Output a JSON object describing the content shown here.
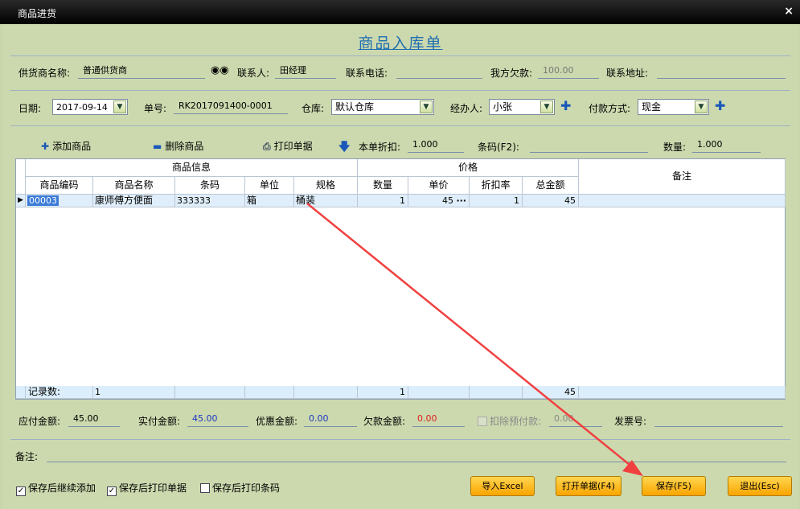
{
  "window": {
    "title": "商品进货",
    "close": "×"
  },
  "form_title": "商品入库单",
  "supplier": {
    "supplier_label": "供货商名称:",
    "supplier_value": "普通供货商",
    "contact_label": "联系人:",
    "contact_value": "田经理",
    "phone_label": "联系电话:",
    "phone_value": "",
    "debt_label": "我方欠款:",
    "debt_value": "100.00",
    "address_label": "联系地址:",
    "address_value": ""
  },
  "order": {
    "date_label": "日期:",
    "date_value": "2017-09-14",
    "no_label": "单号:",
    "no_value": "RK2017091400-0001",
    "warehouse_label": "仓库:",
    "warehouse_value": "默认仓库",
    "handler_label": "经办人:",
    "handler_value": "小张",
    "payment_label": "付款方式:",
    "payment_value": "现金"
  },
  "toolbar": {
    "add": "添加商品",
    "delete": "删除商品",
    "print": "打印单据",
    "discount_label": "本单折扣:",
    "discount_value": "1.000",
    "barcode_label": "条码(F2):",
    "barcode_value": "",
    "qty_label": "数量:",
    "qty_value": "1.000"
  },
  "grid": {
    "group_goods": "商品信息",
    "group_price": "价格",
    "remark": "备注",
    "headers": [
      "商品编码",
      "商品名称",
      "条码",
      "单位",
      "规格",
      "数量",
      "单价",
      "折扣率",
      "总金额"
    ],
    "row": {
      "code": "00003",
      "name": "康师傅方便面",
      "barcode": "333333",
      "unit": "箱",
      "spec": "桶装",
      "qty": "1",
      "price": "45",
      "price_btn": "···",
      "rate": "1",
      "total": "45"
    },
    "footer": {
      "label": "记录数:",
      "count": "1",
      "qty": "1",
      "total": "45"
    }
  },
  "totals": {
    "due_label": "应付金额:",
    "due_value": "45.00",
    "paid_label": "实付金额:",
    "paid_value": "45.00",
    "discount_label": "优惠金额:",
    "discount_value": "0.00",
    "owed_label": "欠款金额:",
    "owed_value": "0.00",
    "deduct_label": "扣除预付款:",
    "deduct_value": "0.00",
    "invoice_label": "发票号:",
    "invoice_value": ""
  },
  "remark_label": "备注:",
  "options": {
    "continue": "保存后继续添加",
    "print_doc": "保存后打印单据",
    "print_barcode": "保存后打印条码",
    "check": "✓"
  },
  "buttons": {
    "import": "导入Excel",
    "open": "打开单据(F4)",
    "save": "保存(F5)",
    "exit": "退出(Esc)"
  },
  "colors": {
    "title": "#1f6fb2",
    "paid": "#1d37c4",
    "discount": "#1d37c4",
    "owed": "#e02020",
    "arrow": "#f04040"
  }
}
